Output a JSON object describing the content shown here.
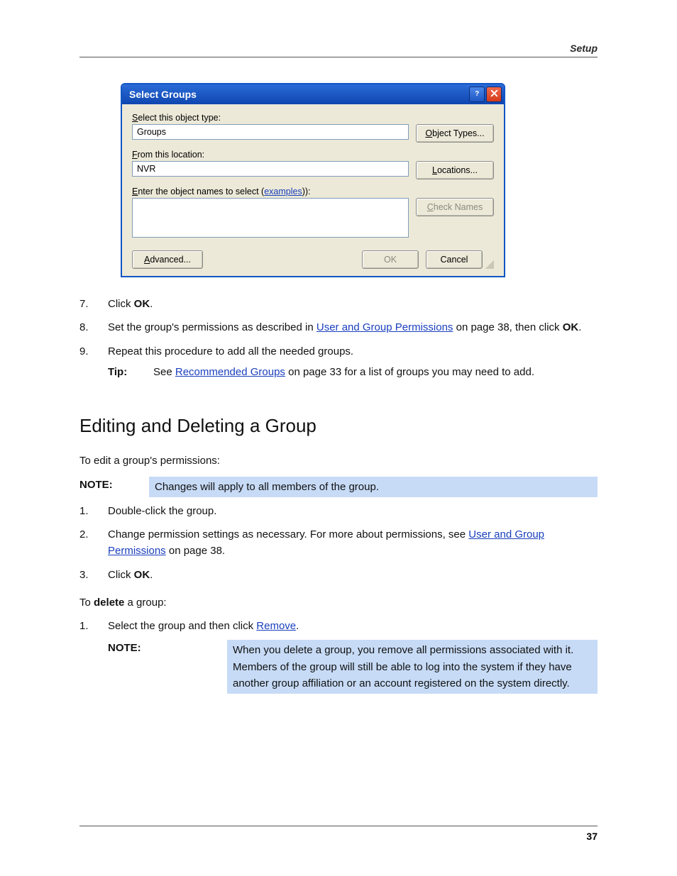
{
  "header": {
    "section": "Setup"
  },
  "dialog": {
    "title": "Select Groups",
    "label_object_type": "Select this object type:",
    "object_type_value": "Groups",
    "btn_object_types": "Object Types...",
    "label_location": "From this location:",
    "location_value": "NVR",
    "btn_locations": "Locations...",
    "label_names_pre": "Enter the object names to select (",
    "label_names_link": "examples",
    "label_names_post": "):",
    "btn_check_names": "Check Names",
    "btn_advanced": "Advanced...",
    "btn_ok": "OK",
    "btn_cancel": "Cancel"
  },
  "para7": {
    "num": "7.",
    "txt_a": "Click ",
    "btn": "OK",
    "txt_b": "."
  },
  "para8": {
    "num": "8.",
    "txt_a": "Set the group's permissions as described in ",
    "link": "User and Group Permissions",
    "txt_b": " on page 38, then click ",
    "btn": "OK",
    "txt_c": "."
  },
  "para9": {
    "num": "9.",
    "txt_a": "Repeat this procedure to add all the needed groups.",
    "tip_label": "Tip:",
    "tip_body_pre": "See ",
    "tip_link": "Recommended Groups",
    "tip_body_post": " on page 33 for a list of groups you may need to add."
  },
  "section_heading": "Editing and Deleting a Group",
  "edit_intro": "To edit a group's permissions:",
  "edit_note_label": "NOTE:",
  "edit_note_body": "Changes will apply to all members of the group.",
  "edit1": {
    "num": "1.",
    "txt": "Double-click the group."
  },
  "edit2": {
    "num": "2.",
    "txt_a": "Change permission settings as necessary. For more about permissions, see ",
    "link": "User and Group Permissions",
    "txt_b": " on page 38."
  },
  "edit3": {
    "num": "3.",
    "txt_a": "Click ",
    "btn": "OK",
    "txt_b": "."
  },
  "delete_intro_a": "To ",
  "delete_intro_b": "delete",
  "delete_intro_c": " a group:",
  "del1": {
    "num": "1.",
    "txt_a": "Select the group and then click ",
    "link": "Remove",
    "txt_b": "."
  },
  "del_note_label": "NOTE:",
  "del_note_body": "When you delete a group, you remove all permissions associated with it. Members of the group will still be able to log into the system if they have another group affiliation or an account registered on the system directly.",
  "footer": {
    "page": "37"
  }
}
